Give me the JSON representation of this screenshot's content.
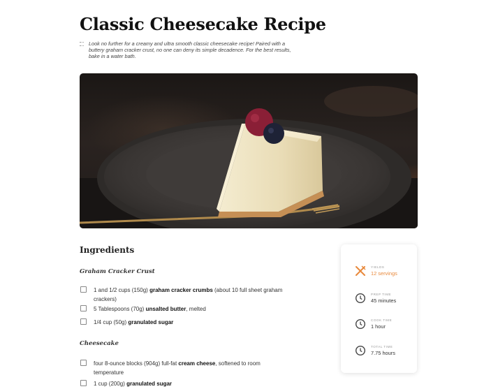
{
  "recipe": {
    "title": "Classic Cheesecake Recipe",
    "intro": "Look no further for a creamy and ultra smooth classic cheesecake recipe! Paired with a buttery graham cracker crust, no one can deny its simple decadence. For the best results, bake in a water bath."
  },
  "ingredients": {
    "heading": "Ingredients",
    "crust": {
      "title": "Graham Cracker Crust",
      "items": [
        {
          "pre": "1 and 1/2 cups (150g) ",
          "bold": "graham cracker crumbs",
          "post": " (about 10 full sheet graham crackers)"
        },
        {
          "pre": "5 Tablespoons (70g) ",
          "bold": "unsalted butter",
          "post": ", melted"
        },
        {
          "pre": "1/4 cup (50g) ",
          "bold": "granulated sugar",
          "post": ""
        }
      ]
    },
    "filling": {
      "title": "Cheesecake",
      "items": [
        {
          "pre": "four 8-ounce blocks (904g) full-fat ",
          "bold": "cream cheese",
          "post": ", softened to room temperature"
        },
        {
          "pre": "1 cup (200g) ",
          "bold": "granulated sugar",
          "post": ""
        }
      ]
    }
  },
  "details": {
    "yields_label": "YIELDS",
    "yields_value": "12 servings",
    "prep_label": "PREP TIME",
    "prep_value": "45 minutes",
    "cook_label": "COOK TIME",
    "cook_value": "1 hour",
    "total_label": "TOTAL TIME",
    "total_value": "7.75 hours",
    "icons": [
      "utensils-icon",
      "clock-icon",
      "clock-icon",
      "clock-icon"
    ],
    "accent_color": "#e8893c"
  }
}
